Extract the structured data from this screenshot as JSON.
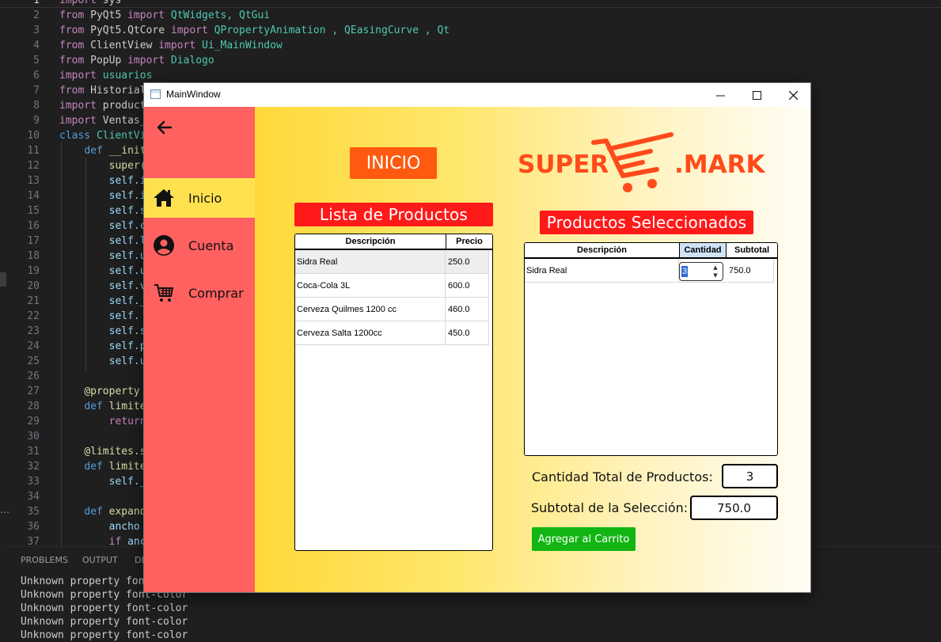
{
  "editor": {
    "line_numbers": [
      "1",
      "2",
      "3",
      "4",
      "5",
      "6",
      "7",
      "8",
      "9",
      "10",
      "11",
      "12",
      "13",
      "14",
      "15",
      "16",
      "17",
      "18",
      "19",
      "20",
      "21",
      "22",
      "23",
      "24",
      "25",
      "26",
      "27",
      "28",
      "29",
      "30",
      "31",
      "32",
      "33",
      "34",
      "35",
      "36",
      "37"
    ],
    "lines": [
      [
        {
          "t": "import",
          "c": "kw"
        },
        {
          "t": " sys"
        }
      ],
      [
        {
          "t": "from",
          "c": "kw"
        },
        {
          "t": " PyQt5 "
        },
        {
          "t": "import",
          "c": "kw"
        },
        {
          "t": " QtWidgets, QtGui",
          "c": "cls"
        }
      ],
      [
        {
          "t": "from",
          "c": "kw"
        },
        {
          "t": " PyQt5.QtCore "
        },
        {
          "t": "import",
          "c": "kw"
        },
        {
          "t": " QPropertyAnimation , QEasingCurve , Qt",
          "c": "cls"
        }
      ],
      [
        {
          "t": "from",
          "c": "kw"
        },
        {
          "t": " ClientView "
        },
        {
          "t": "import",
          "c": "kw"
        },
        {
          "t": " Ui_MainWindow",
          "c": "cls"
        }
      ],
      [
        {
          "t": "from",
          "c": "kw"
        },
        {
          "t": " PopUp "
        },
        {
          "t": "import",
          "c": "kw"
        },
        {
          "t": " Dialogo",
          "c": "cls"
        }
      ],
      [
        {
          "t": "import",
          "c": "kw"
        },
        {
          "t": " usuarios",
          "c": "cls"
        }
      ],
      [
        {
          "t": "from",
          "c": "kw"
        },
        {
          "t": " Historial"
        }
      ],
      [
        {
          "t": "import",
          "c": "kw"
        },
        {
          "t": " product"
        }
      ],
      [
        {
          "t": "import",
          "c": "kw"
        },
        {
          "t": " Ventas_"
        }
      ],
      [
        {
          "t": "class",
          "c": "kw2"
        },
        {
          "t": " ClientVi",
          "c": "cls"
        }
      ],
      [
        {
          "t": "    "
        },
        {
          "t": "def",
          "c": "kw2"
        },
        {
          "t": " __init",
          "c": "fn"
        }
      ],
      [
        {
          "t": "        "
        },
        {
          "t": "super(",
          "c": "fn"
        }
      ],
      [
        {
          "t": "        "
        },
        {
          "t": "self.i",
          "c": "var"
        }
      ],
      [
        {
          "t": "        "
        },
        {
          "t": "self.i",
          "c": "var"
        }
      ],
      [
        {
          "t": "        "
        },
        {
          "t": "self.s",
          "c": "var"
        }
      ],
      [
        {
          "t": "        "
        },
        {
          "t": "self.c",
          "c": "var"
        }
      ],
      [
        {
          "t": "        "
        },
        {
          "t": "self.l",
          "c": "var"
        }
      ],
      [
        {
          "t": "        "
        },
        {
          "t": "self.u",
          "c": "var"
        }
      ],
      [
        {
          "t": "        "
        },
        {
          "t": "self.u",
          "c": "var"
        }
      ],
      [
        {
          "t": "        "
        },
        {
          "t": "self.v",
          "c": "var"
        }
      ],
      [
        {
          "t": "        "
        },
        {
          "t": "self._",
          "c": "var"
        }
      ],
      [
        {
          "t": "        "
        },
        {
          "t": "self.",
          "c": "var"
        }
      ],
      [
        {
          "t": "        "
        },
        {
          "t": "self.s",
          "c": "var"
        }
      ],
      [
        {
          "t": "        "
        },
        {
          "t": "self.p",
          "c": "var"
        }
      ],
      [
        {
          "t": "        "
        },
        {
          "t": "self.u",
          "c": "var"
        }
      ],
      [
        {
          "t": ""
        }
      ],
      [
        {
          "t": "    "
        },
        {
          "t": "@property",
          "c": "dec"
        }
      ],
      [
        {
          "t": "    "
        },
        {
          "t": "def",
          "c": "kw2"
        },
        {
          "t": " limite",
          "c": "fn"
        }
      ],
      [
        {
          "t": "        "
        },
        {
          "t": "return",
          "c": "kw"
        }
      ],
      [
        {
          "t": ""
        }
      ],
      [
        {
          "t": "    "
        },
        {
          "t": "@limites.s",
          "c": "dec"
        }
      ],
      [
        {
          "t": "    "
        },
        {
          "t": "def",
          "c": "kw2"
        },
        {
          "t": " limite",
          "c": "fn"
        }
      ],
      [
        {
          "t": "        "
        },
        {
          "t": "self._",
          "c": "var"
        }
      ],
      [
        {
          "t": ""
        }
      ],
      [
        {
          "t": "    "
        },
        {
          "t": "def",
          "c": "kw2"
        },
        {
          "t": " expand",
          "c": "fn"
        }
      ],
      [
        {
          "t": "        "
        },
        {
          "t": "ancho",
          "c": "var"
        }
      ],
      [
        {
          "t": "        "
        },
        {
          "t": "if",
          "c": "kw"
        },
        {
          "t": " anc",
          "c": "var"
        }
      ]
    ]
  },
  "panel": {
    "tabs": [
      "PROBLEMS",
      "OUTPUT",
      "DE"
    ],
    "lines": [
      "Unknown property font-color",
      "Unknown property font-color",
      "Unknown property font-color",
      "Unknown property font-color",
      "Unknown property font-color"
    ]
  },
  "window": {
    "title": "MainWindow",
    "nav": [
      {
        "label": "Inicio",
        "icon": "home-icon",
        "active": true
      },
      {
        "label": "Cuenta",
        "icon": "account-icon",
        "active": false
      },
      {
        "label": "Comprar",
        "icon": "cart-icon",
        "active": false
      }
    ],
    "page_badge": "INICIO",
    "logo": {
      "left": "SUPER",
      "right": ".MARK"
    },
    "products": {
      "title": "Lista de Productos",
      "headers": [
        "Descripción",
        "Precio"
      ],
      "rows": [
        {
          "desc": "Sidra Real",
          "price": "250.0",
          "selected": true
        },
        {
          "desc": "Coca-Cola 3L",
          "price": "600.0",
          "selected": false
        },
        {
          "desc": "Cerveza Quilmes 1200 cc",
          "price": "460.0",
          "selected": false
        },
        {
          "desc": "Cerveza Salta 1200cc",
          "price": "450.0",
          "selected": false
        }
      ]
    },
    "selected": {
      "title": "Productos Seleccionados",
      "headers": [
        "Descripción",
        "Cantidad",
        "Subtotal"
      ],
      "rows": [
        {
          "desc": "Sidra Real",
          "qty": "3",
          "subtotal": "750.0"
        }
      ]
    },
    "summary": {
      "total_qty_label": "Cantidad Total de Productos:",
      "total_qty": "3",
      "subtotal_label": "Subtotal de la Selección:",
      "subtotal": "750.0"
    },
    "add_button": "Agregar al Carrito"
  },
  "colors": {
    "sidebar": "#ff6060",
    "active_nav": "#ffe150",
    "badge": "#ff5a10",
    "section_title": "#ff1a1a",
    "add_button": "#12b512"
  }
}
